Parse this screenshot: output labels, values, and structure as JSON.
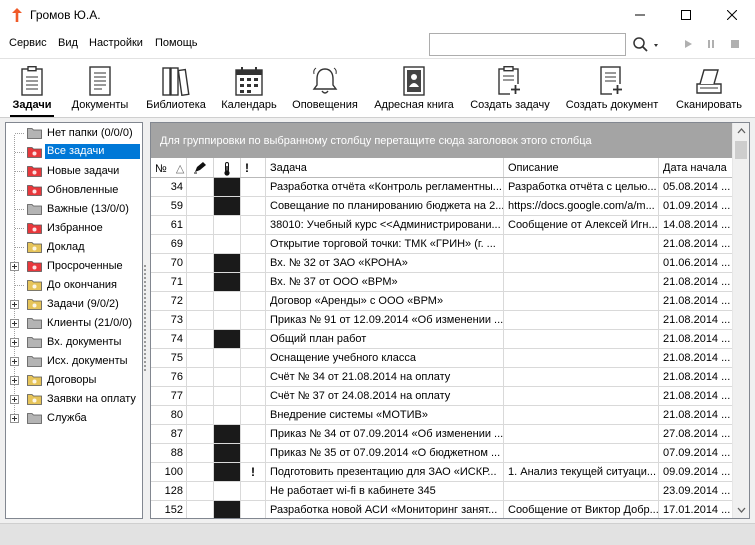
{
  "window": {
    "title": "Громов Ю.А."
  },
  "menu": [
    "Сервис",
    "Вид",
    "Настройки",
    "Помощь"
  ],
  "search": {
    "value": "",
    "placeholder": ""
  },
  "toolbar": [
    {
      "label": "Задачи",
      "icon": "tasks-icon",
      "active": true
    },
    {
      "label": "Документы",
      "icon": "documents-icon",
      "active": false
    },
    {
      "label": "Библиотека",
      "icon": "library-icon",
      "active": false
    },
    {
      "label": "Календарь",
      "icon": "calendar-icon",
      "active": false
    },
    {
      "label": "Оповещения",
      "icon": "bell-icon",
      "active": false
    },
    {
      "label": "Адресная книга",
      "icon": "address-book-icon",
      "active": false
    },
    {
      "label": "Создать задачу",
      "icon": "create-task-icon",
      "active": false
    },
    {
      "label": "Создать документ",
      "icon": "create-document-icon",
      "active": false
    },
    {
      "label": "Сканировать",
      "icon": "scanner-icon",
      "active": false
    }
  ],
  "tree": [
    {
      "label": "Нет папки (0/0/0)",
      "folder": "gray",
      "expandable": false,
      "selected": false
    },
    {
      "label": "Все задачи",
      "folder": "red",
      "expandable": false,
      "selected": true
    },
    {
      "label": "Новые задачи",
      "folder": "red",
      "expandable": false,
      "selected": false
    },
    {
      "label": "Обновленные",
      "folder": "red",
      "expandable": false,
      "selected": false
    },
    {
      "label": "Важные (13/0/0)",
      "folder": "gray",
      "expandable": false,
      "selected": false
    },
    {
      "label": "Избранное",
      "folder": "red",
      "expandable": false,
      "selected": false
    },
    {
      "label": "Доклад",
      "folder": "yellow",
      "expandable": false,
      "selected": false
    },
    {
      "label": "Просроченные",
      "folder": "red",
      "expandable": true,
      "selected": false
    },
    {
      "label": "До окончания",
      "folder": "yellow",
      "expandable": false,
      "selected": false
    },
    {
      "label": "Задачи (9/0/2)",
      "folder": "yellow",
      "expandable": true,
      "selected": false
    },
    {
      "label": "Клиенты (21/0/0)",
      "folder": "gray",
      "expandable": true,
      "selected": false
    },
    {
      "label": "Вх. документы",
      "folder": "gray",
      "expandable": true,
      "selected": false
    },
    {
      "label": "Исх. документы",
      "folder": "gray",
      "expandable": true,
      "selected": false
    },
    {
      "label": "Договоры",
      "folder": "yellow",
      "expandable": true,
      "selected": false
    },
    {
      "label": "Заявки на оплату",
      "folder": "yellow",
      "expandable": true,
      "selected": false
    },
    {
      "label": "Служба",
      "folder": "gray",
      "expandable": true,
      "selected": false
    }
  ],
  "grid": {
    "group_hint": "Для группировки по выбранному столбцу перетащите сюда заголовок этого столбца",
    "columns": {
      "num": "№",
      "sort_indicator": "△",
      "task": "Задача",
      "description": "Описание",
      "start_date": "Дата начала",
      "important": "!"
    },
    "rows": [
      {
        "num": "34",
        "dark": true,
        "flag": "",
        "task": "Разработка отчёта «Контроль регламентны...",
        "desc": "Разработка отчёта с целью...",
        "date": "05.08.2014 ..."
      },
      {
        "num": "59",
        "dark": true,
        "flag": "",
        "task": "Совещание по планированию бюджета на 2...",
        "desc": "https://docs.google.com/a/m...",
        "date": "01.09.2014 ..."
      },
      {
        "num": "61",
        "dark": false,
        "flag": "",
        "task": "38010: Учебный курс <<Администрировани...",
        "desc": "Сообщение от Алексей Игн...",
        "date": "14.08.2014 ..."
      },
      {
        "num": "69",
        "dark": false,
        "flag": "",
        "task": "Открытие торговой точки: ТМК «ГРИН» (г. ...",
        "desc": "",
        "date": "21.08.2014 ..."
      },
      {
        "num": "70",
        "dark": true,
        "flag": "",
        "task": "Вх. № 32 от ЗАО «КРОНА»",
        "desc": "",
        "date": "01.06.2014 ..."
      },
      {
        "num": "71",
        "dark": true,
        "flag": "",
        "task": "Вх. № 37 от ООО «ВРМ»",
        "desc": "",
        "date": "21.08.2014 ..."
      },
      {
        "num": "72",
        "dark": false,
        "flag": "",
        "task": "Договор «Аренды» с ООО «ВРМ»",
        "desc": "",
        "date": "21.08.2014 ..."
      },
      {
        "num": "73",
        "dark": false,
        "flag": "",
        "task": "Приказ № 91 от 12.09.2014 «Об изменении ...",
        "desc": "",
        "date": "21.08.2014 ..."
      },
      {
        "num": "74",
        "dark": true,
        "flag": "",
        "task": "Общий план работ",
        "desc": "",
        "date": "21.08.2014 ..."
      },
      {
        "num": "75",
        "dark": false,
        "flag": "",
        "task": "Оснащение учебного класса",
        "desc": "",
        "date": "21.08.2014 ..."
      },
      {
        "num": "76",
        "dark": false,
        "flag": "",
        "task": "Счёт № 34 от 21.08.2014 на оплату",
        "desc": "",
        "date": "21.08.2014 ..."
      },
      {
        "num": "77",
        "dark": false,
        "flag": "",
        "task": "Счёт № 37 от 24.08.2014 на оплату",
        "desc": "",
        "date": "21.08.2014 ..."
      },
      {
        "num": "80",
        "dark": false,
        "flag": "",
        "task": "Внедрение системы «МОТИВ»",
        "desc": "",
        "date": "21.08.2014 ..."
      },
      {
        "num": "87",
        "dark": true,
        "flag": "",
        "task": "Приказ № 34 от 07.09.2014 «Об изменении ...",
        "desc": "",
        "date": "27.08.2014 ..."
      },
      {
        "num": "88",
        "dark": true,
        "flag": "",
        "task": "Приказ № 35 от 07.09.2014 «О бюджетном ...",
        "desc": "",
        "date": "07.09.2014 ..."
      },
      {
        "num": "100",
        "dark": true,
        "flag": "!",
        "task": "Подготовить презентацию для ЗАО «ИСКР...",
        "desc": "1. Анализ текущей ситуаци...",
        "date": "09.09.2014 ..."
      },
      {
        "num": "128",
        "dark": false,
        "flag": "",
        "task": "Не работает wi-fi в кабинете 345",
        "desc": "",
        "date": "23.09.2014 ..."
      },
      {
        "num": "152",
        "dark": true,
        "flag": "",
        "task": "Разработка новой АСИ «Мониторинг занят...",
        "desc": "Сообщение от Виктор Добр...",
        "date": "17.01.2014 ..."
      }
    ]
  },
  "colors": {
    "selection": "#0078d7",
    "folder_red": "#e8383c",
    "folder_yellow": "#e6c45a",
    "folder_gray": "#b4b4b4",
    "group_panel": "#a4a4a4",
    "app_icon": "#f05a28"
  }
}
